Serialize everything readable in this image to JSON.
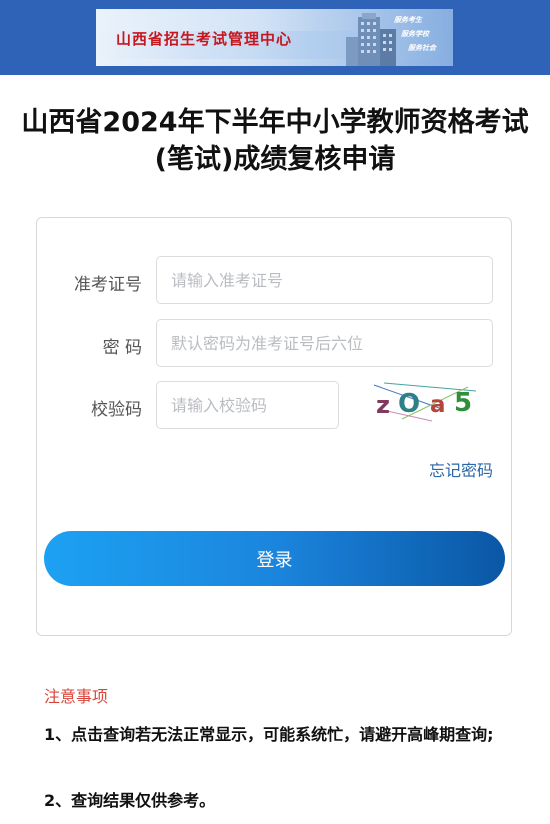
{
  "banner": {
    "title": "山西省招生考试管理中心",
    "slogans": [
      "服务考生",
      "服务学校",
      "服务社会"
    ]
  },
  "page_title": "山西省2024年下半年中小学教师资格考试(笔试)成绩复核申请",
  "form": {
    "exam_number": {
      "label": "准考证号",
      "placeholder": "请输入准考证号",
      "value": ""
    },
    "password": {
      "label": "密 码",
      "placeholder": "默认密码为准考证号后六位",
      "value": ""
    },
    "captcha": {
      "label": "校验码",
      "placeholder": "请输入校验码",
      "value": "",
      "image_text": "zOa5"
    },
    "forgot_password_link": "忘记密码",
    "login_button": "登录"
  },
  "notes": {
    "heading": "注意事项",
    "items": [
      "1、点击查询若无法正常显示，可能系统忙，请避开高峰期查询;",
      "2、查询结果仅供参考。"
    ]
  },
  "colors": {
    "header_bar": "#2f63b8",
    "banner_title": "#c8161d",
    "button_gradient_start": "#1da1f2",
    "button_gradient_end": "#0a57a5",
    "link": "#2a67a8",
    "notes_heading": "#d9463d"
  }
}
